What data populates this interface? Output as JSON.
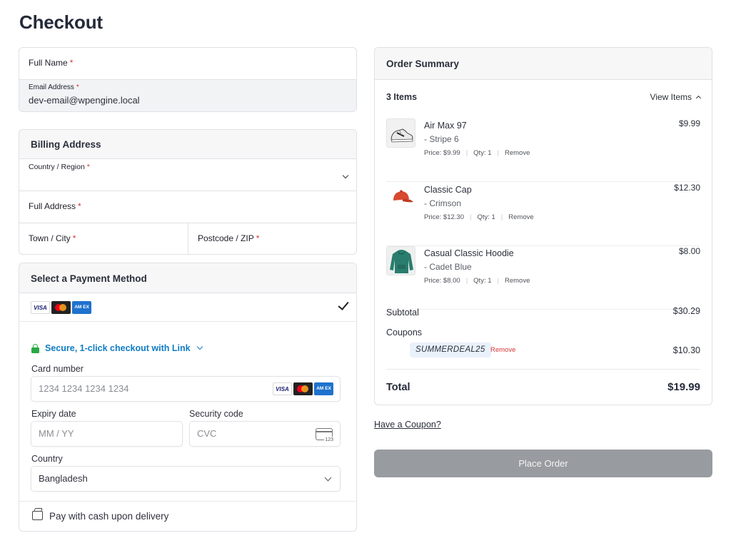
{
  "page": {
    "title": "Checkout"
  },
  "contact": {
    "full_name_label": "Full Name",
    "email_label": "Email Address",
    "email_value": "dev-email@wpengine.local"
  },
  "billing": {
    "title": "Billing Address",
    "country_label": "Country / Region",
    "address_label": "Full Address",
    "town_label": "Town / City",
    "postcode_label": "Postcode / ZIP"
  },
  "required_mark": "*",
  "payment": {
    "title": "Select a Payment Method",
    "brands": {
      "visa": "VISA",
      "amex": "AM EX"
    },
    "link_text": "Secure, 1-click checkout with Link",
    "card_number_label": "Card number",
    "card_number_placeholder": "1234 1234 1234 1234",
    "expiry_label": "Expiry date",
    "expiry_placeholder": "MM / YY",
    "cvc_label": "Security code",
    "cvc_placeholder": "CVC",
    "cvc_icon_text": "123",
    "country_label": "Country",
    "country_value": "Bangladesh",
    "cash_label": "Pay with cash upon delivery"
  },
  "summary": {
    "title": "Order Summary",
    "items_count": "3 Items",
    "view_items": "View Items",
    "items": [
      {
        "name": "Air Max 97",
        "variant": "- Stripe 6",
        "price_text": "Price: $9.99",
        "qty": "Qty: 1",
        "remove": "Remove",
        "total": "$9.99"
      },
      {
        "name": "Classic Cap",
        "variant": "- Crimson",
        "price_text": "Price: $12.30",
        "qty": "Qty: 1",
        "remove": "Remove",
        "total": "$12.30"
      },
      {
        "name": "Casual Classic Hoodie",
        "variant": "- Cadet Blue",
        "price_text": "Price: $8.00",
        "qty": "Qty: 1",
        "remove": "Remove",
        "total": "$8.00"
      }
    ],
    "subtotal_label": "Subtotal",
    "subtotal_value": "$30.29",
    "coupons_label": "Coupons",
    "coupon_code": "SUMMERDEAL25",
    "coupon_remove": "Remove",
    "coupon_value": "$10.30",
    "total_label": "Total",
    "total_value": "$19.99"
  },
  "have_coupon": "Have a Coupon?",
  "place_order": "Place Order",
  "colors": {
    "accent_link": "#0f7cc4",
    "secure_green": "#27a844",
    "required_red": "#d63638",
    "button_disabled": "#989b9f",
    "coupon_chip": "#e9f1fb"
  }
}
